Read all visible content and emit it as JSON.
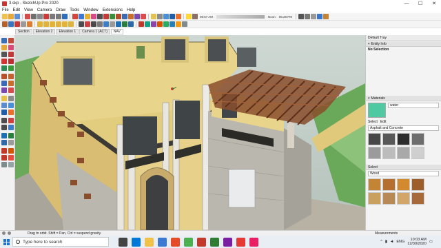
{
  "window": {
    "title": "3.skp - SketchUp Pro 2020",
    "minimize": "—",
    "maximize": "☐",
    "close": "✕"
  },
  "menu": [
    "File",
    "Edit",
    "View",
    "Camera",
    "Draw",
    "Tools",
    "Window",
    "Extensions",
    "Help"
  ],
  "shadow_times": {
    "time_1": "05:57 AM",
    "noon": "Noon",
    "time_2": "05:28 PM"
  },
  "scene_tabs": [
    {
      "label": "Section",
      "active": false
    },
    {
      "label": "Elevation 2",
      "active": false
    },
    {
      "label": "Elevation 1",
      "active": false
    },
    {
      "label": "Camera 1 (ACT)",
      "active": false
    },
    {
      "label": "NAV",
      "active": true
    }
  ],
  "tray": {
    "title": "Default Tray",
    "entity_info": {
      "title": "Entity Info",
      "value": "No Selection"
    },
    "materials": {
      "title": "Materials",
      "current_name": "water",
      "current_color": "#4fc9a1",
      "tabs": [
        "Select",
        "Edit"
      ],
      "collection": "Asphalt and Concrete",
      "swatches": [
        "#474747",
        "#585858",
        "#2d2d2d",
        "#6d6d6d",
        "#9b9b9b",
        "#bcbcbc",
        "#a9a9a9",
        "#cfcfcf",
        "#d8d8d8",
        "#c4c4c4",
        "#ebebeb",
        "#e8e8e8"
      ]
    },
    "select": {
      "title": "Select",
      "collection": "Wood",
      "swatches": [
        "#c48436",
        "#b5702f",
        "#d38a2e",
        "#9e5e2b",
        "#caa061",
        "#b88855",
        "#d2a56a",
        "#a7683a"
      ]
    }
  },
  "status": {
    "hint": "Drag to orbit. Shift = Pan, Ctrl = suspend gravity.",
    "measurements": "Measurements"
  },
  "taskbar": {
    "search_placeholder": "Type here to search",
    "language": "ENG",
    "time": "10:03 AM",
    "date": "12/30/2020"
  },
  "colors": {
    "wall_yellow": "#e8d48a",
    "roof_shadow": "#3d3a33",
    "pergola": "#8a4e2c",
    "stone": "#b9b7ae",
    "grass": "#6aa85a",
    "sky": "#c7d3cf"
  }
}
